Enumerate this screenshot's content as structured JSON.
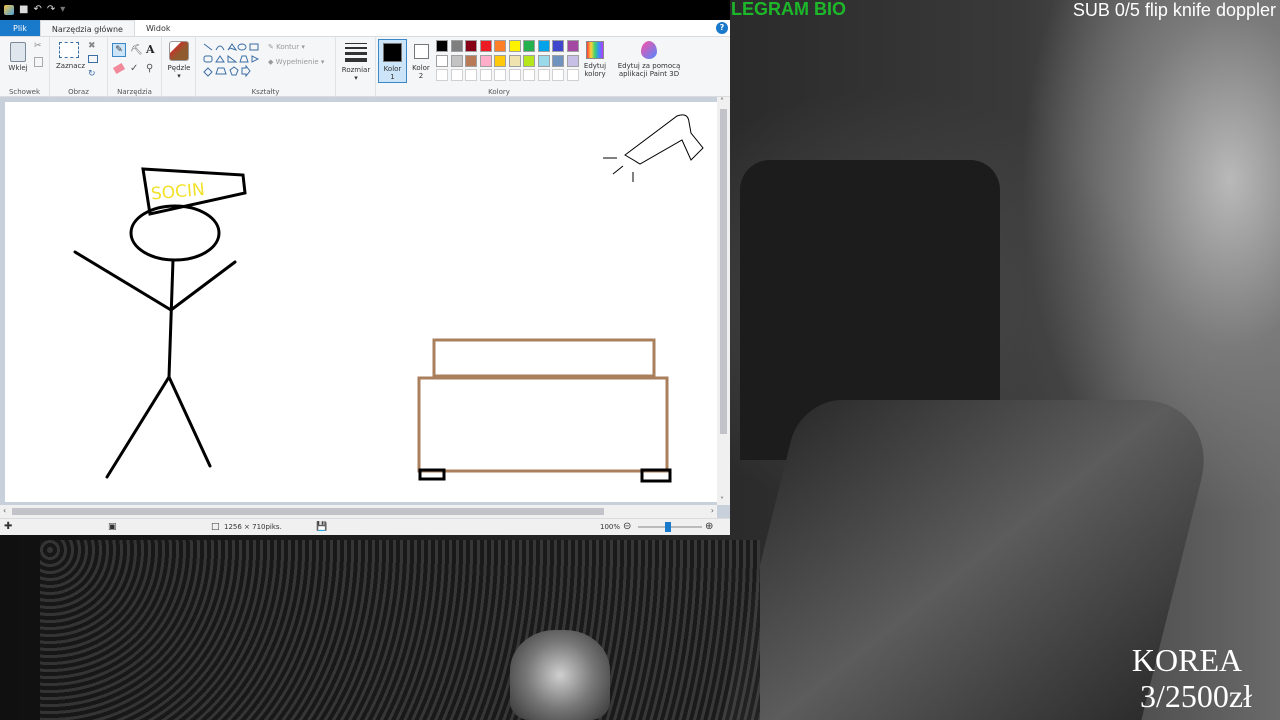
{
  "overlays": {
    "telegram": "LEGRAM BIO",
    "sub_counter": "SUB 0/5 flip knife doppler",
    "korea_label": "KOREA",
    "korea_progress": "3/2500zł"
  },
  "paint": {
    "quick_access": [
      "save-icon",
      "undo-icon",
      "redo-icon"
    ],
    "tabs": [
      "Plik",
      "Narzędzia główne",
      "Widok"
    ],
    "help": "?",
    "ribbon": {
      "clipboard": {
        "paste": "Wklej",
        "group": "Schowek"
      },
      "image": {
        "select": "Zaznacz",
        "group": "Obraz"
      },
      "tools": {
        "group": "Narzędzia"
      },
      "brushes": {
        "label": "Pędzle"
      },
      "shapes": {
        "outline": "Kontur",
        "fill": "Wypełnienie",
        "group": "Kształty"
      },
      "size": {
        "label": "Rozmiar"
      },
      "color1": {
        "label": "Kolor",
        "num": "1",
        "value": "#000000"
      },
      "color2": {
        "label": "Kolor",
        "num": "2",
        "value": "#ffffff"
      },
      "colors": {
        "group": "Kolory",
        "row1": [
          "#000000",
          "#7f7f7f",
          "#880015",
          "#ed1c24",
          "#ff7f27",
          "#fff200",
          "#22b14c",
          "#00a2e8",
          "#3f48cc",
          "#a349a4"
        ],
        "row2": [
          "#ffffff",
          "#c3c3c3",
          "#b97a57",
          "#ffaec9",
          "#ffc90e",
          "#efe4b0",
          "#b5e61d",
          "#99d9ea",
          "#7092be",
          "#c8bfe7"
        ],
        "row3": [
          "#ffffff",
          "#ffffff",
          "#ffffff",
          "#ffffff",
          "#ffffff",
          "#ffffff",
          "#ffffff",
          "#ffffff",
          "#ffffff",
          "#ffffff"
        ]
      },
      "edit_colors": {
        "line1": "Edytuj",
        "line2": "kolory"
      },
      "paint3d": {
        "line1": "Edytuj za pomocą",
        "line2": "aplikacji Paint 3D"
      }
    },
    "drawing": {
      "hat_text": "SOCIN",
      "hat_text_color": "#f2e12a",
      "stroke_color": "#000000",
      "bed_color": "#a97f5c"
    },
    "status": {
      "dimensions": "1256 × 710piks.",
      "zoom": "100%"
    }
  }
}
